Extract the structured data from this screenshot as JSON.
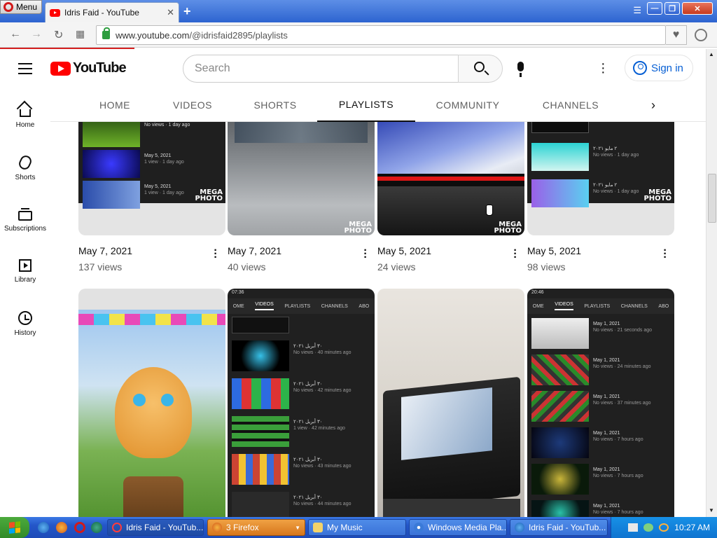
{
  "browser": {
    "menu_label": "Menu",
    "tab_title": "Idris Faid - YouTube",
    "url_host": "www.youtube.com",
    "url_path": "/@idrisfaid2895/playlists"
  },
  "youtube": {
    "logo_text": "YouTube",
    "search_placeholder": "Search",
    "signin_label": "Sign in",
    "guide": [
      {
        "label": "Home",
        "icon": "home-icon"
      },
      {
        "label": "Shorts",
        "icon": "shorts-icon"
      },
      {
        "label": "Subscriptions",
        "icon": "subscriptions-icon"
      },
      {
        "label": "Library",
        "icon": "library-icon"
      },
      {
        "label": "History",
        "icon": "history-icon"
      }
    ],
    "tabs": [
      "HOME",
      "VIDEOS",
      "SHORTS",
      "PLAYLISTS",
      "COMMUNITY",
      "CHANNELS"
    ],
    "active_tab": "PLAYLISTS"
  },
  "cards_row1": [
    {
      "date": "May 7, 2021",
      "views": "137 views"
    },
    {
      "date": "May 7, 2021",
      "views": "40 views"
    },
    {
      "date": "May 5, 2021",
      "views": "24 views"
    },
    {
      "date": "May 5, 2021",
      "views": "98 views"
    }
  ],
  "thumb_text": {
    "watermark_1": "MEGA",
    "watermark_2": "PHOTO",
    "t1_rows": [
      {
        "title": "No views · 1 day ago",
        "sub": ""
      },
      {
        "title": "May 5, 2021",
        "sub": "1 view · 1 day ago"
      },
      {
        "title": "May 5, 2021",
        "sub": "1 view · 1 day ago"
      }
    ],
    "t4_rows": [
      {
        "title": "٢ مايو ٢٠٢١",
        "sub": "No views · 1 day ago"
      },
      {
        "title": "٢ مايو ٢٠٢١",
        "sub": "No views · 1 day ago"
      }
    ],
    "phone1_time": "07:36",
    "phone2_time": "20:46",
    "phone_tabs": [
      "OME",
      "VIDEOS",
      "PLAYLISTS",
      "CHANNELS",
      "ABO"
    ],
    "phone1_rows": [
      {
        "title": "٣٠ أبريل ٢٠٢١",
        "sub": "No views · 40 minutes ago"
      },
      {
        "title": "٣٠ أبريل ٢٠٢١",
        "sub": "No views · 42 minutes ago"
      },
      {
        "title": "٣٠ أبريل ٢٠٢١",
        "sub": "1 view · 42 minutes ago"
      },
      {
        "title": "٣٠ أبريل ٢٠٢١",
        "sub": "No views · 43 minutes ago"
      },
      {
        "title": "٣٠ أبريل ٢٠٢١",
        "sub": "No views · 44 minutes ago"
      }
    ],
    "phone2_rows": [
      {
        "title": "May 1, 2021",
        "sub": "No views · 21 seconds ago"
      },
      {
        "title": "May 1, 2021",
        "sub": "No views · 24 minutes ago"
      },
      {
        "title": "May 1, 2021",
        "sub": "No views · 37 minutes ago"
      },
      {
        "title": "May 1, 2021",
        "sub": "No views · 7 hours ago"
      },
      {
        "title": "May 1, 2021",
        "sub": "No views · 7 hours ago"
      },
      {
        "title": "May 1, 2021",
        "sub": "No views · 7 hours ago"
      }
    ]
  },
  "taskbar": {
    "tasks": [
      "Idris Faid - YouTub...",
      "3 Firefox",
      "My Music",
      "Windows Media Pla...",
      "Idris Faid - YouTub..."
    ],
    "clock": "10:27 AM"
  },
  "colors": {
    "youtube_red": "#ff0000",
    "signin_blue": "#065fd4",
    "xp_blue": "#2456c8"
  }
}
